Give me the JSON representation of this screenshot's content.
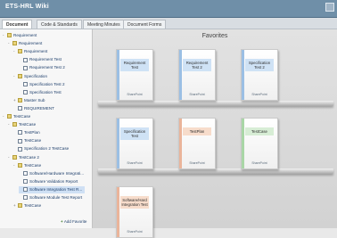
{
  "window": {
    "title": "ETS-HRL Wiki"
  },
  "tabs": [
    "Document",
    "Code & Standards",
    "Meeting Minutes",
    "Document Forms"
  ],
  "sidebar": {
    "items": [
      {
        "label": "Requirement",
        "level": 0,
        "icon": "folder-icon",
        "twisty": "-"
      },
      {
        "label": "Requirement",
        "level": 1,
        "icon": "folder-icon",
        "twisty": "-"
      },
      {
        "label": "Requirement",
        "level": 2,
        "icon": "folder-icon",
        "twisty": "-"
      },
      {
        "label": "Requirement Test",
        "level": 3,
        "icon": "document-icon",
        "twisty": ""
      },
      {
        "label": "Requirement Test 2",
        "level": 3,
        "icon": "document-icon",
        "twisty": ""
      },
      {
        "label": "Specification",
        "level": 2,
        "icon": "folder-icon",
        "twisty": "-"
      },
      {
        "label": "Specification Test 2",
        "level": 3,
        "icon": "document-icon",
        "twisty": ""
      },
      {
        "label": "Specification Test",
        "level": 3,
        "icon": "document-icon",
        "twisty": ""
      },
      {
        "label": "Master Sub",
        "level": 2,
        "icon": "folder-icon",
        "twisty": "+"
      },
      {
        "label": "REQUIREMENT",
        "level": 2,
        "icon": "document-icon",
        "twisty": ""
      },
      {
        "label": "TestCase",
        "level": 0,
        "icon": "folder-icon",
        "twisty": "-"
      },
      {
        "label": "TestCase",
        "level": 1,
        "icon": "folder-icon",
        "twisty": "-"
      },
      {
        "label": "TestPlan",
        "level": 2,
        "icon": "document-icon",
        "twisty": ""
      },
      {
        "label": "TestCase",
        "level": 2,
        "icon": "document-icon",
        "twisty": ""
      },
      {
        "label": "Specification 2 TestCase",
        "level": 2,
        "icon": "document-icon",
        "twisty": ""
      },
      {
        "label": "TestCase 2",
        "level": 1,
        "icon": "folder-icon",
        "twisty": "-"
      },
      {
        "label": "TestCase",
        "level": 2,
        "icon": "folder-icon",
        "twisty": "-"
      },
      {
        "label": "Software/Hardware Integrati...",
        "level": 3,
        "icon": "document-icon",
        "twisty": ""
      },
      {
        "label": "Software Validation Report",
        "level": 3,
        "icon": "document-icon",
        "twisty": ""
      },
      {
        "label": "Software Integration Test R...",
        "level": 3,
        "icon": "document-icon",
        "twisty": "",
        "selected": true
      },
      {
        "label": "Software Module Test Report",
        "level": 3,
        "icon": "document-icon",
        "twisty": ""
      },
      {
        "label": "TestCase",
        "level": 2,
        "icon": "folder-icon",
        "twisty": "+"
      }
    ],
    "add_favorite": "Add Favorite"
  },
  "favorites": {
    "title": "Favorites",
    "brand": "SharePoint",
    "docs": [
      {
        "label": "Requirement Test",
        "color": "blue"
      },
      {
        "label": "Requirement Test 2",
        "color": "blue"
      },
      {
        "label": "Specification Test 2",
        "color": "blue"
      },
      {
        "label": "Specification Test",
        "color": "blue"
      },
      {
        "label": "TestPlan",
        "color": "orange"
      },
      {
        "label": "TestCase",
        "color": "green"
      },
      {
        "label": "Software/Hard Integration Test",
        "color": "orange"
      }
    ]
  },
  "colors": {
    "titlebar": "#6f8fa8",
    "doc_blue": "#cfe2f5",
    "doc_orange": "#f7dccb",
    "doc_green": "#d7edd5"
  }
}
